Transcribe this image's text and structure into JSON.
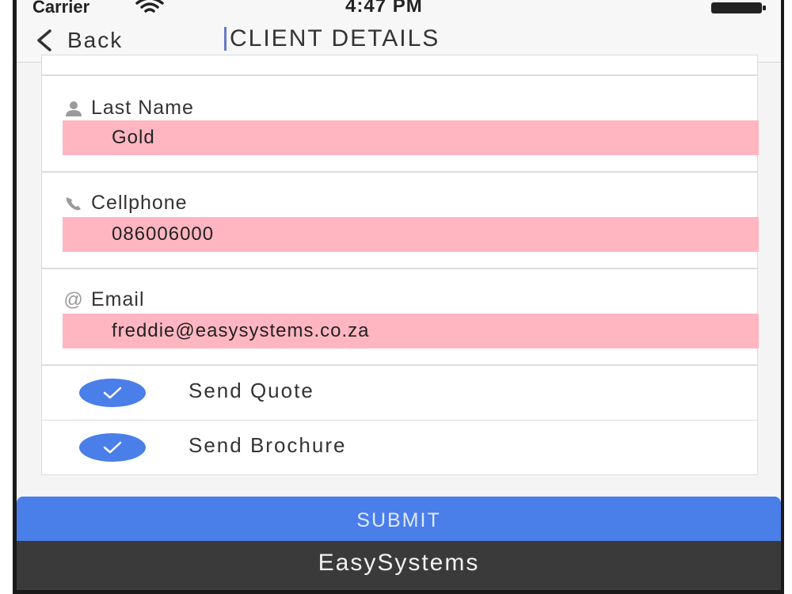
{
  "status_bar": {
    "carrier": "Carrier",
    "time": "4:47 PM",
    "wifi_icon": "wifi-icon",
    "battery_icon": "battery-icon"
  },
  "nav": {
    "back_label": "Back",
    "back_icon": "chevron-left-icon",
    "title": "CLIENT DETAILS"
  },
  "fields": {
    "last_name": {
      "label": "Last Name",
      "icon": "person-icon",
      "value": "Gold"
    },
    "cellphone": {
      "label": "Cellphone",
      "icon": "phone-icon",
      "value": "086006000"
    },
    "email": {
      "label": "Email",
      "icon": "at-icon",
      "icon_glyph": "@",
      "value": "freddie@easysystems.co.za"
    }
  },
  "options": {
    "send_quote": {
      "label": "Send Quote",
      "checked": true
    },
    "send_brochure": {
      "label": "Send Brochure",
      "checked": true
    }
  },
  "submit": {
    "label": "SUBMIT"
  },
  "footer": {
    "brand": "EasySystems"
  },
  "colors": {
    "accent": "#4a7ee8",
    "field_highlight": "#ffb6c1",
    "footer_bg": "#3a3a3a",
    "background": "#f4f4f4"
  }
}
